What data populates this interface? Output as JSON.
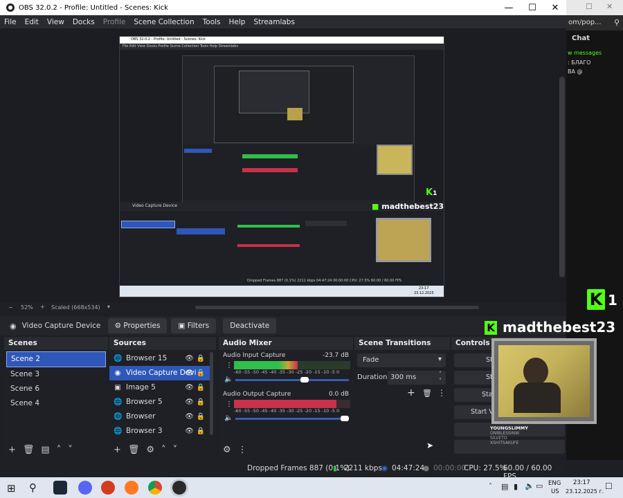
{
  "window": {
    "title": "OBS 32.0.2 - Profile: Untitled - Scenes: Kick"
  },
  "menu": [
    "File",
    "Edit",
    "View",
    "Docks",
    "Profile",
    "Scene Collection",
    "Tools",
    "Help",
    "Streamlabs"
  ],
  "browser": {
    "address": "om/pop...",
    "chat_label": "Chat",
    "chat_line1": "w messages",
    "chat_line2": ": БЛАГО",
    "chat_line3": "ВА @"
  },
  "preview": {
    "zoom": "52%",
    "scaled": "Scaled (668x534)",
    "inner_title": "OBS 32.0.2 - Profile: Untitled - Scenes: Kick",
    "inner_menu": "File  Edit  View  Docks  Profile  Scene Collection  Tools  Help  Streamlabs",
    "inner_source": "Video Capture Device",
    "inner_k_label": "1",
    "inner_name": "madthebest23",
    "inner_status": "Dropped Frames 887 (0.1%)  2211 kbps  04:47:24  00:00:00  CPU: 27.5%  60.00 / 60.00 FPS",
    "inner_clock": "23:17",
    "inner_date": "23.12.2025"
  },
  "source_toolbar": {
    "source_name": "Video Capture Device",
    "properties": "Properties",
    "filters": "Filters",
    "deactivate": "Deactivate"
  },
  "scenes": {
    "header": "Scenes",
    "items": [
      "Scene 2",
      "Scene 3",
      "Scene 6",
      "Scene 4"
    ],
    "selected": "Scene 2"
  },
  "sources": {
    "header": "Sources",
    "items": [
      {
        "name": "Browser 15",
        "icon": "globe-icon"
      },
      {
        "name": "Video Capture Devi",
        "icon": "camera-icon"
      },
      {
        "name": "Image 5",
        "icon": "image-icon"
      },
      {
        "name": "Browser 5",
        "icon": "globe-icon"
      },
      {
        "name": "Browser",
        "icon": "globe-icon"
      },
      {
        "name": "Browser 3",
        "icon": "globe-icon"
      }
    ],
    "selected": "Video Capture Devi"
  },
  "audio_mixer": {
    "header": "Audio Mixer",
    "channels": [
      {
        "name": "Audio Input Capture",
        "db": "-23.7 dB",
        "level": 0.55,
        "volume": 0.62
      },
      {
        "name": "Audio Output Capture",
        "db": "0.0 dB",
        "level": 0.88,
        "volume": 1.0
      }
    ],
    "scale": "-60 -55 -50 -45 -40 -35 -30 -25 -20 -15 -10 -5 0"
  },
  "scene_transitions": {
    "header": "Scene Transitions",
    "transition": "Fade",
    "duration_label": "Duration",
    "duration_value": "300 ms"
  },
  "controls": {
    "header": "Controls",
    "buttons": [
      "St",
      "St",
      "Sta",
      "Start V"
    ]
  },
  "statusbar": {
    "dropped": "Dropped Frames 887 (0.1%)",
    "kbps": "2211 kbps",
    "rec_time": "04:47:24",
    "stream_time": "00:00:00",
    "cpu": "CPU: 27.5%",
    "fps": "60.00 / 60.00 FPS"
  },
  "overlay": {
    "k_number": "1",
    "name": "madthebest23",
    "chat_user": "YOUNGSLIMMY",
    "chat_lines": [
      "ONIBLESSINW",
      "SILVETO",
      "XSHITSAKUFE"
    ]
  },
  "taskbar": {
    "lang": "ENG",
    "region": "US",
    "time": "23:17",
    "date": "23.12.2025 г."
  },
  "colors": {
    "accent": "#2f56b9",
    "kick_green": "#53fc18",
    "meter_green": "#2fbf4a",
    "meter_red": "#c8324a"
  }
}
